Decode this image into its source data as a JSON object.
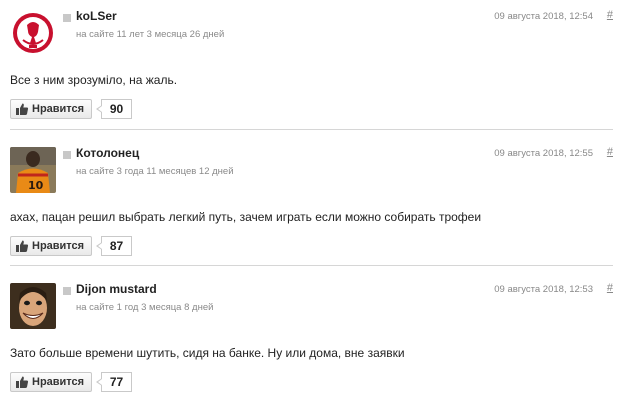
{
  "comments": [
    {
      "username": "koLSer",
      "tenure": "на сайте 11 лет 3 месяца 26 дней",
      "date": "09 августа 2018, 12:54",
      "hash": "#",
      "text": "Все з ним зрозуміло, на жаль.",
      "like_label": "Нравится",
      "likes": "90",
      "avatar_icon": "liverpool-crest-avatar"
    },
    {
      "username": "Котолонец",
      "tenure": "на сайте 3 года 11 месяцев 12 дней",
      "date": "09 августа 2018, 12:55",
      "hash": "#",
      "text": "ахах, пацан решил выбрать легкий путь, зачем играть если можно собирать трофеи",
      "like_label": "Нравится",
      "likes": "87",
      "avatar_icon": "football-player-avatar"
    },
    {
      "username": "Dijon mustard",
      "tenure": "на сайте 1 год 3 месяца 8 дней",
      "date": "09 августа 2018, 12:53",
      "hash": "#",
      "text": "Зато больше времени шутить, сидя на банке. Ну или дома, вне заявки",
      "like_label": "Нравится",
      "likes": "77",
      "avatar_icon": "grinning-face-avatar"
    }
  ],
  "colors": {
    "liverpool_red": "#c8102e",
    "divider": "#d6d6d6",
    "meta_text": "#888888"
  }
}
